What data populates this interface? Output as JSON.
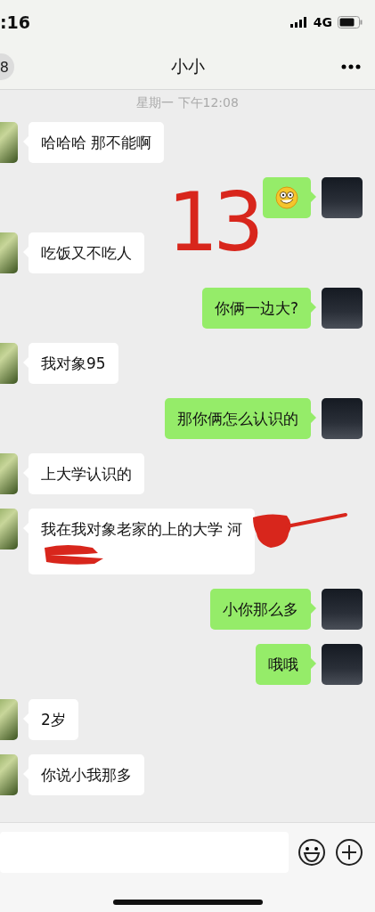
{
  "status_bar": {
    "time": ":16",
    "network": "4G"
  },
  "header": {
    "unread_count": "8",
    "title": "小小"
  },
  "timestamp": "星期一 下午12:08",
  "messages": [
    {
      "outgoing": false,
      "kind": "text",
      "text": "哈哈哈 那不能啊",
      "redacted": false
    },
    {
      "outgoing": true,
      "kind": "emoji",
      "redacted": false
    },
    {
      "outgoing": false,
      "kind": "text",
      "text": "吃饭又不吃人",
      "redacted": false
    },
    {
      "outgoing": true,
      "kind": "text",
      "text": "你俩一边大?",
      "redacted": false
    },
    {
      "outgoing": false,
      "kind": "text",
      "text": "我对象95",
      "redacted": false
    },
    {
      "outgoing": true,
      "kind": "text",
      "text": "那你俩怎么认识的",
      "redacted": false
    },
    {
      "outgoing": false,
      "kind": "text",
      "text": "上大学认识的",
      "redacted": false
    },
    {
      "outgoing": false,
      "kind": "text",
      "text": "我在我对象老家的上的大学 河",
      "redacted": true
    },
    {
      "outgoing": true,
      "kind": "text",
      "text": "小你那么多",
      "redacted": false
    },
    {
      "outgoing": true,
      "kind": "text",
      "text": "哦哦",
      "redacted": false
    },
    {
      "outgoing": false,
      "kind": "text",
      "text": "2岁",
      "redacted": false
    },
    {
      "outgoing": false,
      "kind": "text",
      "text": "你说小我那多",
      "redacted": false
    }
  ],
  "annotation": "13"
}
